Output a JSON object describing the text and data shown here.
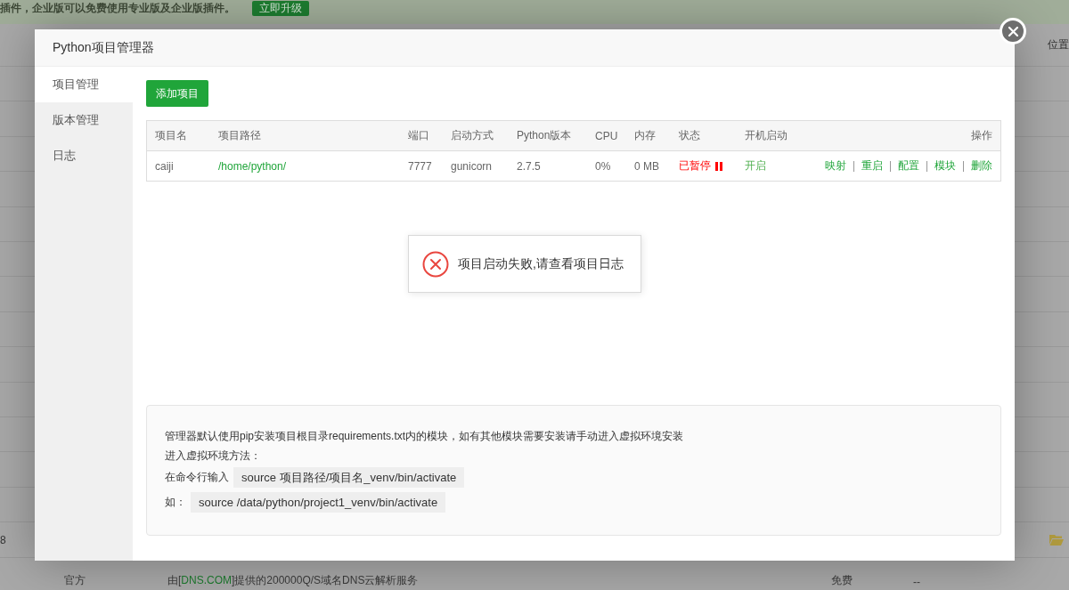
{
  "background_page": {
    "banner": {
      "text": "插件，企业版可以免费使用专业版及企业版插件。",
      "button": "立即升级"
    },
    "header": {
      "column_label": "位置"
    },
    "partial_row": {
      "column_1": "8"
    },
    "last_row": {
      "column_1": "官方",
      "column_2": {
        "before": "由[",
        "link": "DNS.COM",
        "after": "]提供的200000Q/S域名DNS云解析服务"
      },
      "column_3": "免费",
      "column_4": "--"
    }
  },
  "dialog": {
    "title": "Python项目管理器",
    "sidebar": [
      {
        "label": "项目管理",
        "selected": true
      },
      {
        "label": "版本管理",
        "selected": false
      },
      {
        "label": "日志",
        "selected": false
      }
    ],
    "add_button": "添加项目",
    "table": {
      "columns": [
        "项目名",
        "项目路径",
        "端口",
        "启动方式",
        "Python版本",
        "CPU",
        "内存",
        "状态",
        "开机启动",
        "操作"
      ],
      "rows": [
        {
          "name": "caiji",
          "path": "/home/python/",
          "port": "7777",
          "startup": "gunicorn",
          "python_version": "2.7.5",
          "cpu": "0%",
          "memory": "0 MB",
          "status": {
            "label": "已暂停",
            "running": false
          },
          "autostart": {
            "label": "开启",
            "on": true
          },
          "actions": [
            "映射",
            "重启",
            "配置",
            "模块",
            "删除"
          ]
        }
      ]
    },
    "toast": {
      "kind": "error",
      "message": "项目启动失败,请查看项目日志"
    },
    "notes": [
      {
        "kind": "text",
        "text": "管理器默认使用pip安装项目根目录requirements.txt内的模块，如有其他模块需要安装请手动进入虚拟环境安装"
      },
      {
        "kind": "text",
        "text": "进入虚拟环境方法："
      },
      {
        "kind": "command",
        "label": "在命令行输入",
        "code": "source 项目路径/项目名_venv/bin/activate"
      },
      {
        "kind": "command",
        "label": "如：",
        "code": "source /data/python/project1_venv/bin/activate"
      }
    ]
  }
}
